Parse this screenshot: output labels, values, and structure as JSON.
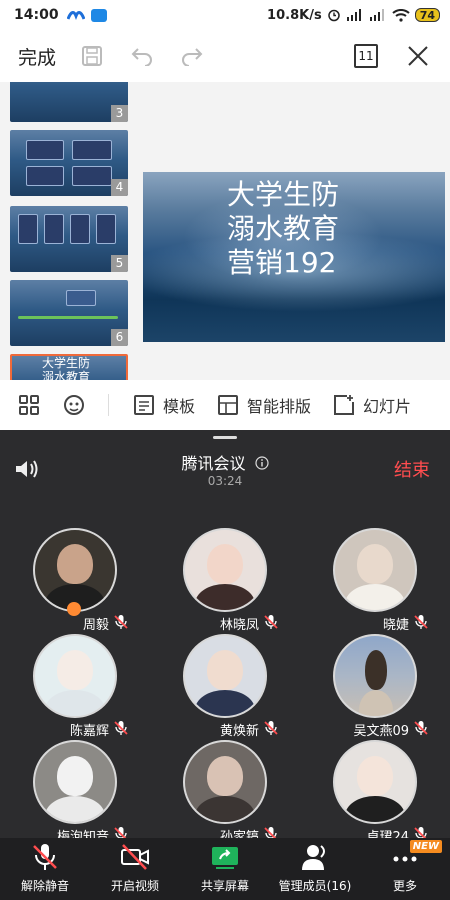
{
  "status_bar": {
    "time": "14:00",
    "network_speed": "10.8K/s",
    "battery": "74"
  },
  "editor": {
    "done_label": "完成",
    "slide_count": "11"
  },
  "thumbnails": [
    {
      "num": "3",
      "title": ""
    },
    {
      "num": "4",
      "title": ""
    },
    {
      "num": "5",
      "title": ""
    },
    {
      "num": "6",
      "title": ""
    },
    {
      "num": "",
      "title": "大学生防\n溺水教育"
    }
  ],
  "main_slide": {
    "title": "大学生防\n溺水教育\n营销192"
  },
  "toolbar": {
    "template_label": "模板",
    "smart_layout_label": "智能排版",
    "slide_label": "幻灯片"
  },
  "meeting": {
    "title": "腾讯会议",
    "duration": "03:24",
    "end_label": "结束",
    "participants": [
      {
        "name": "周毅",
        "mic_muted": true,
        "host": true
      },
      {
        "name": "林晓凤",
        "mic_muted": true,
        "host": false
      },
      {
        "name": "晓婕",
        "mic_muted": true,
        "host": false
      },
      {
        "name": "陈嘉辉",
        "mic_muted": true,
        "host": false
      },
      {
        "name": "黄焕新",
        "mic_muted": true,
        "host": false
      },
      {
        "name": "吴文燕09",
        "mic_muted": true,
        "host": false
      },
      {
        "name": "梅泡知音",
        "mic_muted": true,
        "host": false
      },
      {
        "name": "孙家镐",
        "mic_muted": true,
        "host": false
      },
      {
        "name": "卓珺24",
        "mic_muted": true,
        "host": false
      }
    ],
    "controls": {
      "unmute_label": "解除静音",
      "video_label": "开启视频",
      "share_label": "共享屏幕",
      "members_label": "管理成员(16)",
      "more_label": "更多",
      "new_tag": "NEW"
    }
  },
  "colors": {
    "end_red": "#ff4d4f",
    "share_green": "#1fb35b",
    "new_orange": "#f58b1f",
    "selected_border": "#f06a3a"
  }
}
